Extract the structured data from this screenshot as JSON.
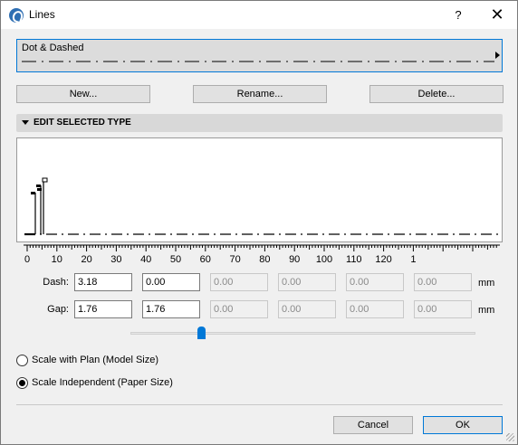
{
  "window": {
    "title": "Lines",
    "help_label": "?",
    "close_label": "✕"
  },
  "line_type": {
    "name": "Dot & Dashed"
  },
  "buttons": {
    "new": "New...",
    "rename": "Rename...",
    "delete": "Delete..."
  },
  "section": {
    "title": "EDIT SELECTED TYPE"
  },
  "ruler": {
    "labels": [
      "0",
      "10",
      "20",
      "30",
      "40",
      "50",
      "60",
      "70",
      "80",
      "90",
      "100",
      "110",
      "120",
      "1"
    ]
  },
  "dash": {
    "label": "Dash:",
    "values": [
      "3.18",
      "0.00",
      "0.00",
      "0.00",
      "0.00",
      "0.00"
    ],
    "unit": "mm"
  },
  "gap": {
    "label": "Gap:",
    "values": [
      "1.76",
      "1.76",
      "0.00",
      "0.00",
      "0.00",
      "0.00"
    ],
    "unit": "mm"
  },
  "scale_options": {
    "model": "Scale with Plan (Model Size)",
    "paper": "Scale Independent (Paper Size)",
    "selected": "paper"
  },
  "footer": {
    "cancel": "Cancel",
    "ok": "OK"
  },
  "colors": {
    "accent": "#0078d7",
    "section_bg": "#d8d8d8"
  }
}
